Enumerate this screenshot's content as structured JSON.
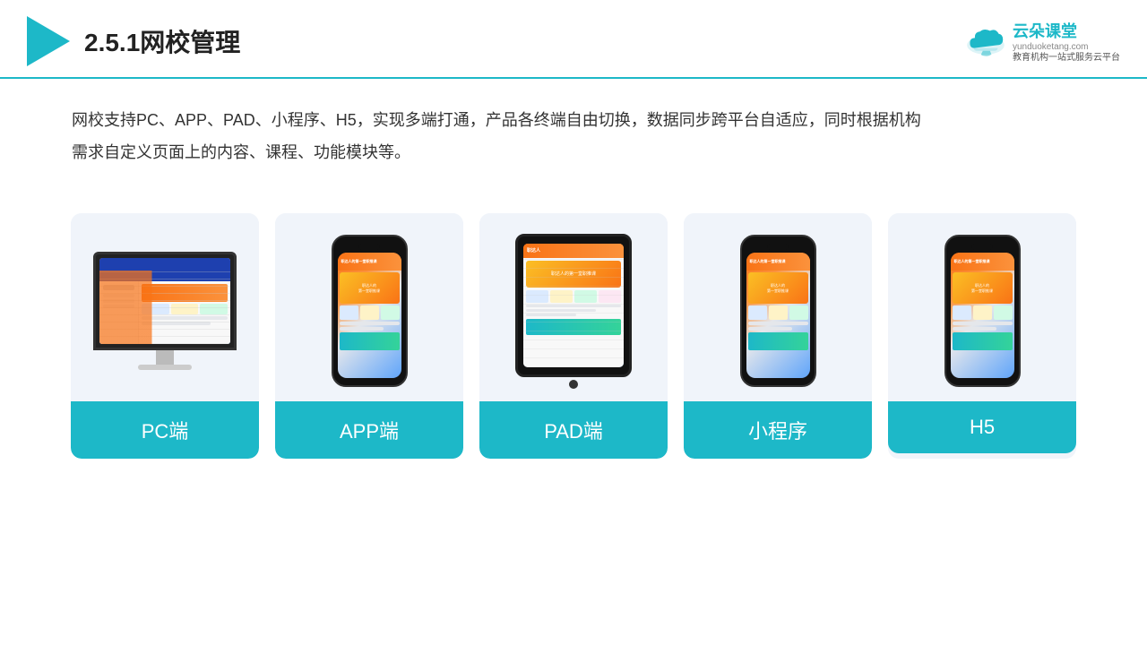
{
  "header": {
    "title": "2.5.1网校管理",
    "brand": {
      "name": "云朵课堂",
      "url": "yunduoketang.com",
      "tagline": "教育机构一站\n式服务云平台"
    }
  },
  "description": "网校支持PC、APP、PAD、小程序、H5，实现多端打通，产品各终端自由切换，数据同步跨平台自适应，同时根据机构\n需求自定义页面上的内容、课程、功能模块等。",
  "cards": [
    {
      "id": "pc",
      "label": "PC端",
      "device": "pc"
    },
    {
      "id": "app",
      "label": "APP端",
      "device": "phone"
    },
    {
      "id": "pad",
      "label": "PAD端",
      "device": "tablet"
    },
    {
      "id": "miniapp",
      "label": "小程序",
      "device": "phone"
    },
    {
      "id": "h5",
      "label": "H5",
      "device": "phone"
    }
  ],
  "colors": {
    "primary": "#1db8c8",
    "background": "#f0f4fa",
    "text": "#333333"
  }
}
